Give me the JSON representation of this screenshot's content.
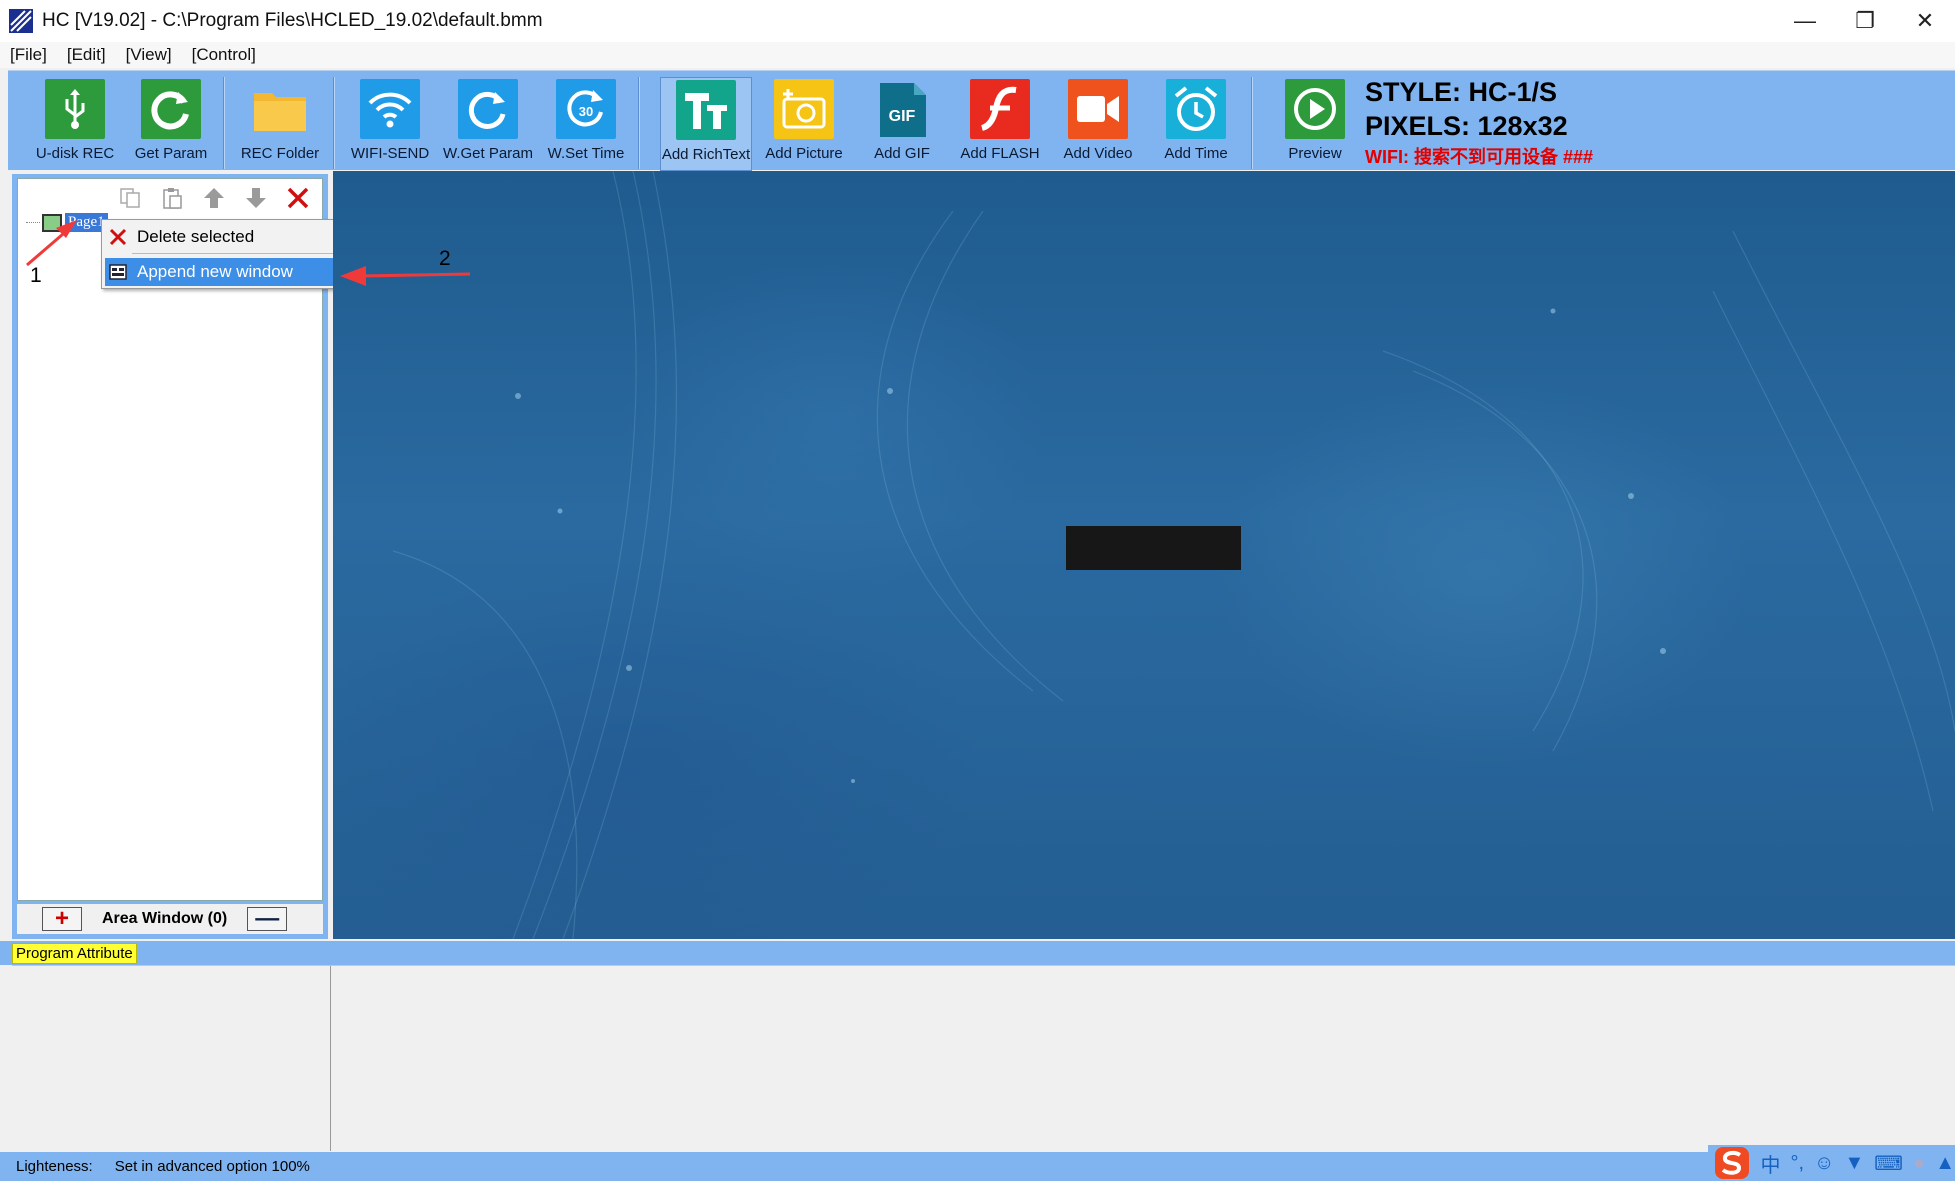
{
  "window": {
    "title": "HC [V19.02] - C:\\Program Files\\HCLED_19.02\\default.bmm",
    "controls": [
      "minimize",
      "restore",
      "close"
    ]
  },
  "menu": [
    "[File]",
    "[Edit]",
    "[View]",
    "[Control]"
  ],
  "toolbar": {
    "udisk_rec": "U-disk REC",
    "get_param": "Get Param",
    "rec_folder": "REC Folder",
    "wifi_send": "WIFI-SEND",
    "w_get_param": "W.Get Param",
    "w_set_time": "W.Set Time",
    "add_richtext": "Add RichText",
    "add_picture": "Add Picture",
    "add_gif": "Add GIF",
    "add_flash": "Add FLASH",
    "add_video": "Add Video",
    "add_time": "Add Time",
    "preview": "Preview",
    "gif_icon_text": "GIF",
    "timer_icon_text": "30"
  },
  "info": {
    "style": "STYLE: HC-1/S",
    "pixels": "PIXELS: 128x32",
    "wifi": "WIFI:  搜索不到可用设备 ###"
  },
  "tree": {
    "node_label": "Page1"
  },
  "context_menu": {
    "delete": "Delete selected",
    "append": "Append new window"
  },
  "area_window": {
    "label": "Area Window (0)"
  },
  "attribute": {
    "tab": "Program Attribute"
  },
  "status": {
    "lightness_label": "Lighteness:",
    "lightness_value": "Set in advanced option  100%"
  },
  "annotations": {
    "step1": "1",
    "step2": "2"
  },
  "ime": {
    "lang": "中"
  },
  "colors": {
    "toolbar_bg": "#7fb4f0",
    "selection": "#3d8ee6",
    "warning_text": "#e30000",
    "arrow": "#f03a3a"
  }
}
